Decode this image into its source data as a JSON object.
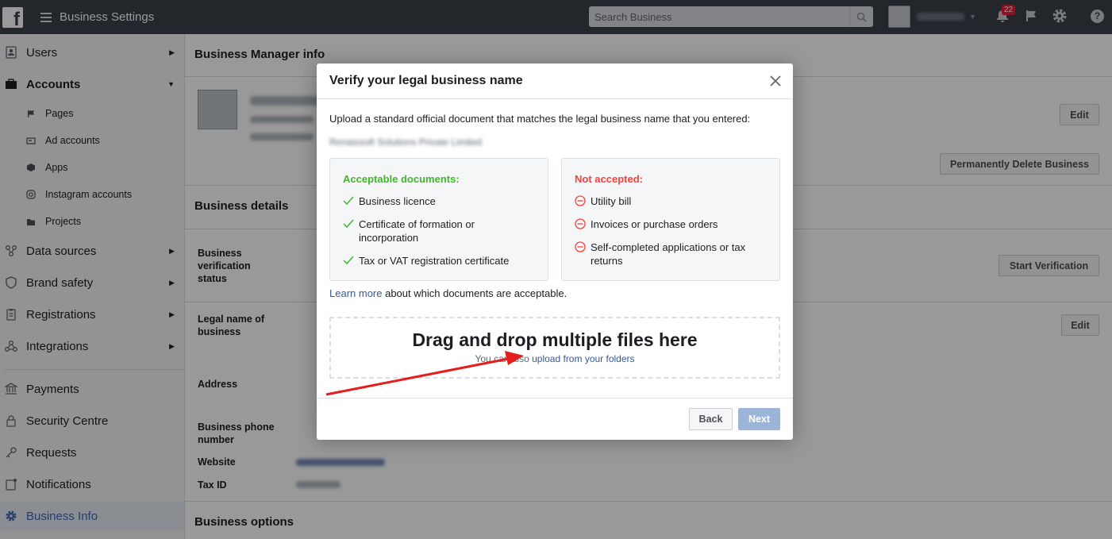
{
  "topbar": {
    "app_title": "Business Settings",
    "search_placeholder": "Search Business",
    "account_name": "Renaissoft",
    "notification_count": "22"
  },
  "sidebar": {
    "items": [
      {
        "label": "Users",
        "icon": "users-icon",
        "caret": "▶"
      },
      {
        "label": "Accounts",
        "icon": "briefcase-icon",
        "caret": "▼"
      },
      {
        "label": "Data sources",
        "icon": "data-sources-icon",
        "caret": "▶"
      },
      {
        "label": "Brand safety",
        "icon": "shield-icon",
        "caret": "▶"
      },
      {
        "label": "Registrations",
        "icon": "clipboard-icon",
        "caret": "▶"
      },
      {
        "label": "Integrations",
        "icon": "integrations-icon",
        "caret": "▶"
      },
      {
        "label": "Payments",
        "icon": "bank-icon"
      },
      {
        "label": "Security Centre",
        "icon": "lock-icon"
      },
      {
        "label": "Requests",
        "icon": "key-icon"
      },
      {
        "label": "Notifications",
        "icon": "notifications-icon"
      },
      {
        "label": "Business Info",
        "icon": "gear-icon"
      }
    ],
    "sub_items": [
      {
        "label": "Pages",
        "icon": "flag-icon"
      },
      {
        "label": "Ad accounts",
        "icon": "ad-account-icon"
      },
      {
        "label": "Apps",
        "icon": "cube-icon"
      },
      {
        "label": "Instagram accounts",
        "icon": "instagram-icon"
      },
      {
        "label": "Projects",
        "icon": "folder-icon"
      }
    ]
  },
  "main": {
    "business_manager_info": "Business Manager info",
    "business_details": "Business details",
    "business_options": "Business options",
    "edit": "Edit",
    "permanently_delete": "Permanently Delete Business",
    "start_verification": "Start Verification",
    "labels": {
      "verification_status": "Business verification status",
      "legal_name": "Legal name of business",
      "address": "Address",
      "phone": "Business phone number",
      "website": "Website",
      "tax_id": "Tax ID"
    }
  },
  "modal": {
    "title": "Verify your legal business name",
    "intro": "Upload a standard official document that matches the legal business name that you entered:",
    "legal_name": "Renaissoft Solutions Private Limited",
    "acceptable": {
      "heading": "Acceptable documents:",
      "heading_color": "#42b72a",
      "items": [
        "Business licence",
        "Certificate of formation or incorporation",
        "Tax or VAT registration certificate"
      ]
    },
    "not_accepted": {
      "heading": "Not accepted:",
      "heading_color": "#fa3e3e",
      "items": [
        "Utility bill",
        "Invoices or purchase orders",
        "Self-completed applications or tax returns"
      ]
    },
    "learn_more_link": "Learn more",
    "learn_more_rest": " about which documents are acceptable.",
    "dropzone_title": "Drag and drop multiple files here",
    "dropzone_prefix": "You can also ",
    "dropzone_link": "upload from your folders",
    "back": "Back",
    "next": "Next"
  },
  "colors": {
    "topbar": "#3b4149",
    "link": "#385898",
    "active": "#4267b2",
    "annotation_arrow": "#e41e1e"
  }
}
